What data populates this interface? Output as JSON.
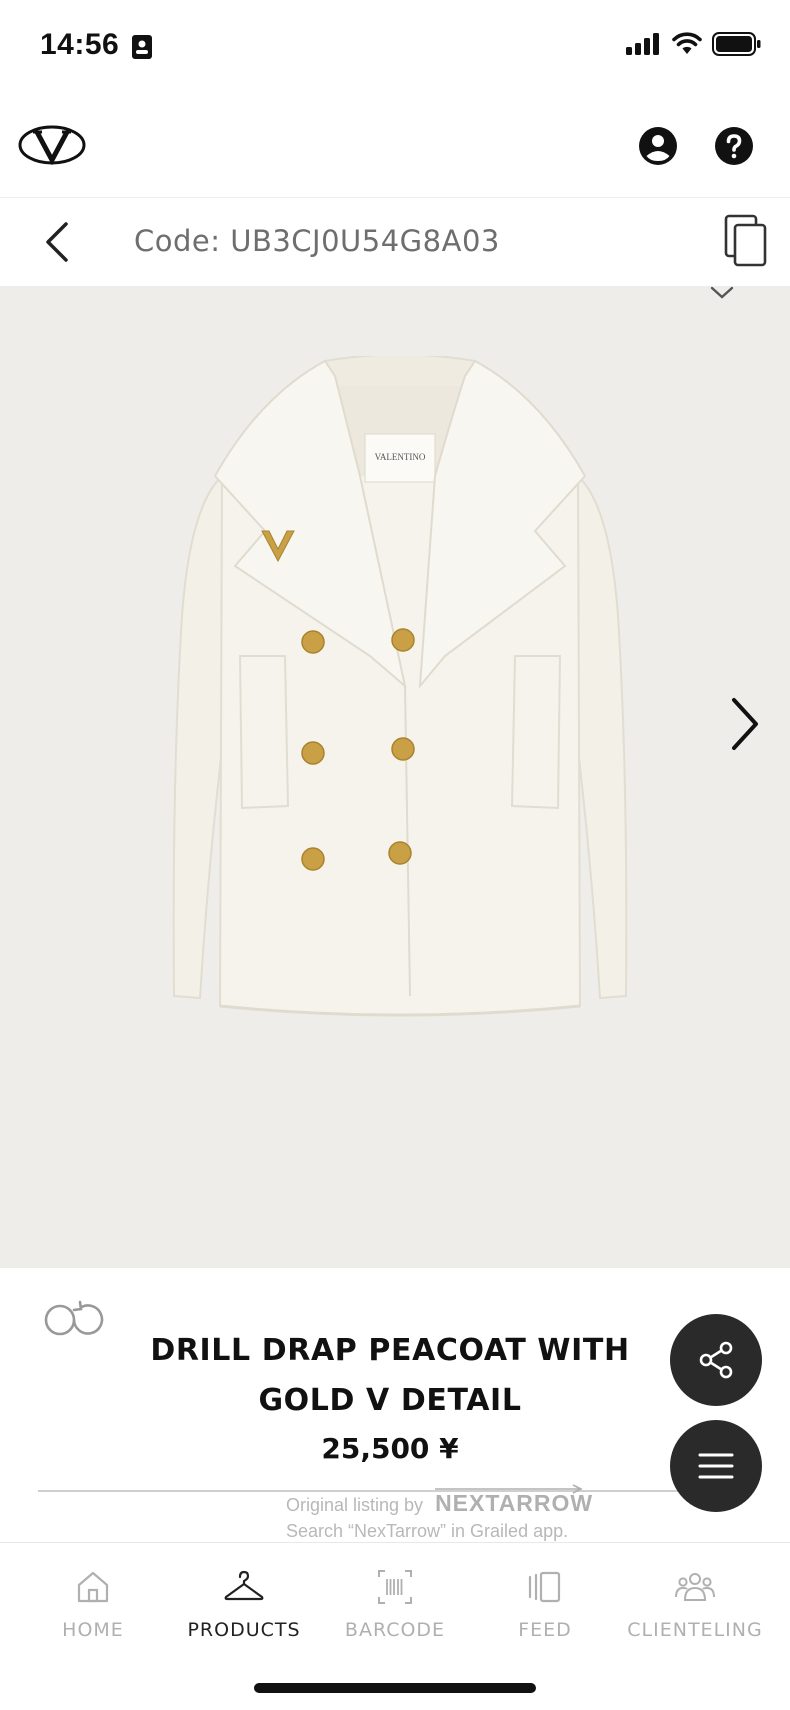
{
  "status_bar": {
    "time": "14:56"
  },
  "header": {
    "logo_icon": "valentino-v-logo",
    "account_icon": "account-icon",
    "help_icon": "help-icon"
  },
  "code_bar": {
    "code_text": "Code: UB3CJ0U54G8A03"
  },
  "product": {
    "title": "DRILL DRAP PEACOAT WITH GOLD V DETAIL",
    "price": "25,500 ¥"
  },
  "watermark": {
    "prefix": "Original listing by",
    "brand": "NEXTARROW",
    "line2": "Search “NexTarrow” in Grailed app."
  },
  "tabs": [
    {
      "label": "HOME",
      "icon": "home-icon"
    },
    {
      "label": "PRODUCTS",
      "icon": "hanger-icon"
    },
    {
      "label": "BARCODE",
      "icon": "barcode-icon"
    },
    {
      "label": "FEED",
      "icon": "feed-icon"
    },
    {
      "label": "CLIENTELING",
      "icon": "people-icon"
    }
  ],
  "colors": {
    "image_bg": "#efedea",
    "fab_bg": "#2a2a2a",
    "inactive_tab": "#b0b0b0",
    "coat": "#f5f2ea",
    "gold": "#c9a045"
  }
}
